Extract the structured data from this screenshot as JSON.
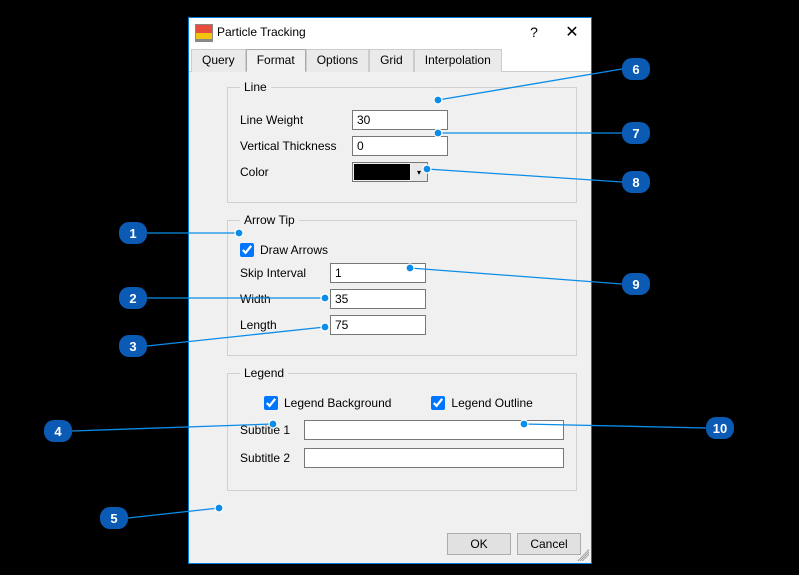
{
  "window": {
    "title": "Particle Tracking",
    "help_symbol": "?",
    "close_symbol": "✕"
  },
  "tabs": {
    "items": [
      "Query",
      "Format",
      "Options",
      "Grid",
      "Interpolation"
    ],
    "active_index": 1
  },
  "line": {
    "legend": "Line",
    "weight_label": "Line Weight",
    "weight_value": "30",
    "thickness_label": "Vertical Thickness",
    "thickness_value": "0",
    "color_label": "Color",
    "color_value": "#000000"
  },
  "arrow": {
    "legend": "Arrow Tip",
    "draw_label": "Draw Arrows",
    "draw_checked": true,
    "skip_label": "Skip Interval",
    "skip_value": "1",
    "width_label": "Width",
    "width_value": "35",
    "length_label": "Length",
    "length_value": "75"
  },
  "legend_group": {
    "legend": "Legend",
    "bg_label": "Legend Background",
    "bg_checked": true,
    "outline_label": "Legend Outline",
    "outline_checked": true,
    "sub1_label": "Subtitle 1",
    "sub1_value": "",
    "sub2_label": "Subtitle 2",
    "sub2_value": ""
  },
  "buttons": {
    "ok": "OK",
    "cancel": "Cancel"
  },
  "callouts": {
    "c1": "1",
    "c2": "2",
    "c3": "3",
    "c4": "4",
    "c5": "5",
    "c6": "6",
    "c7": "7",
    "c8": "8",
    "c9": "9",
    "c10": "10"
  }
}
